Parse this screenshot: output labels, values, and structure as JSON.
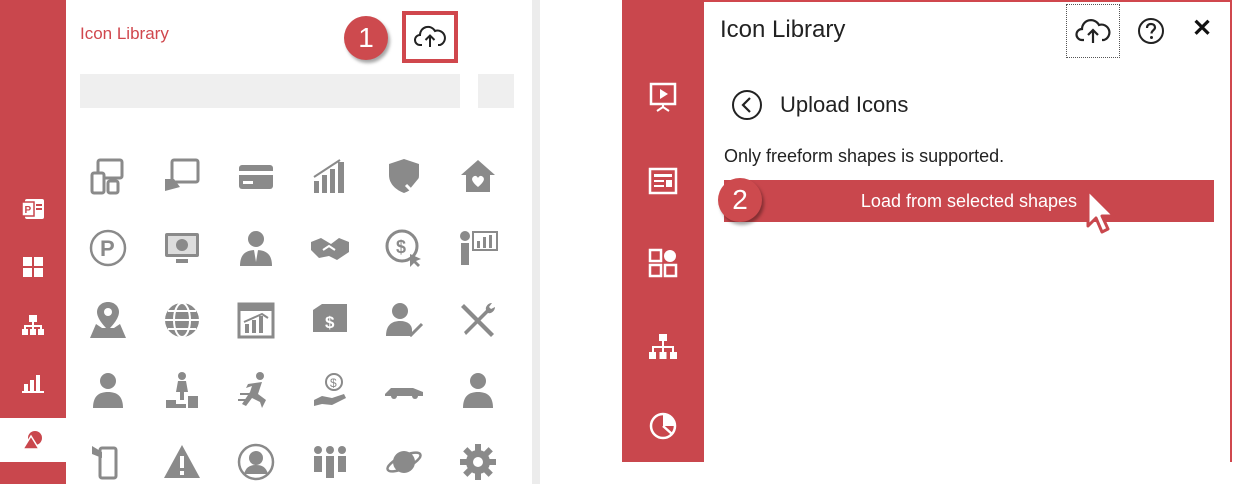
{
  "left": {
    "title": "Icon Library",
    "badge": "1",
    "rail_icons": [
      "powerpoint-icon",
      "grid-icon",
      "hierarchy-icon",
      "bar-chart-icon",
      "shapes-icon"
    ],
    "grid_icons": [
      [
        "devices-icon",
        "tablet-hand-icon",
        "credit-card-icon",
        "growth-bars-icon",
        "shield-check-icon",
        "home-heart-icon"
      ],
      [
        "parking-icon",
        "monitor-chart-icon",
        "businessman-icon",
        "handshake-icon",
        "dollar-click-icon",
        "presenter-chart-icon"
      ],
      [
        "map-pin-icon",
        "globe-icon",
        "calendar-chart-icon",
        "cash-icon",
        "user-check-icon",
        "tools-icon"
      ],
      [
        "user-icon",
        "climbing-stairs-icon",
        "runner-icon",
        "hand-coin-icon",
        "car-icon",
        "person-icon"
      ],
      [
        "phone-hand-icon",
        "warning-icon",
        "user-circle-icon",
        "team-icon",
        "planet-icon",
        "gear-icon"
      ]
    ]
  },
  "right": {
    "title": "Icon Library",
    "subtitle": "Upload Icons",
    "note": "Only freeform shapes is supported.",
    "load_button": "Load from selected shapes",
    "badge": "2",
    "close": "✕",
    "rail_icons": [
      "slideshow-icon",
      "news-icon",
      "apps-icon",
      "hierarchy-icon",
      "pie-chart-icon"
    ]
  },
  "colors": {
    "accent": "#c9474d",
    "icon_gray": "#8a8a8a"
  }
}
